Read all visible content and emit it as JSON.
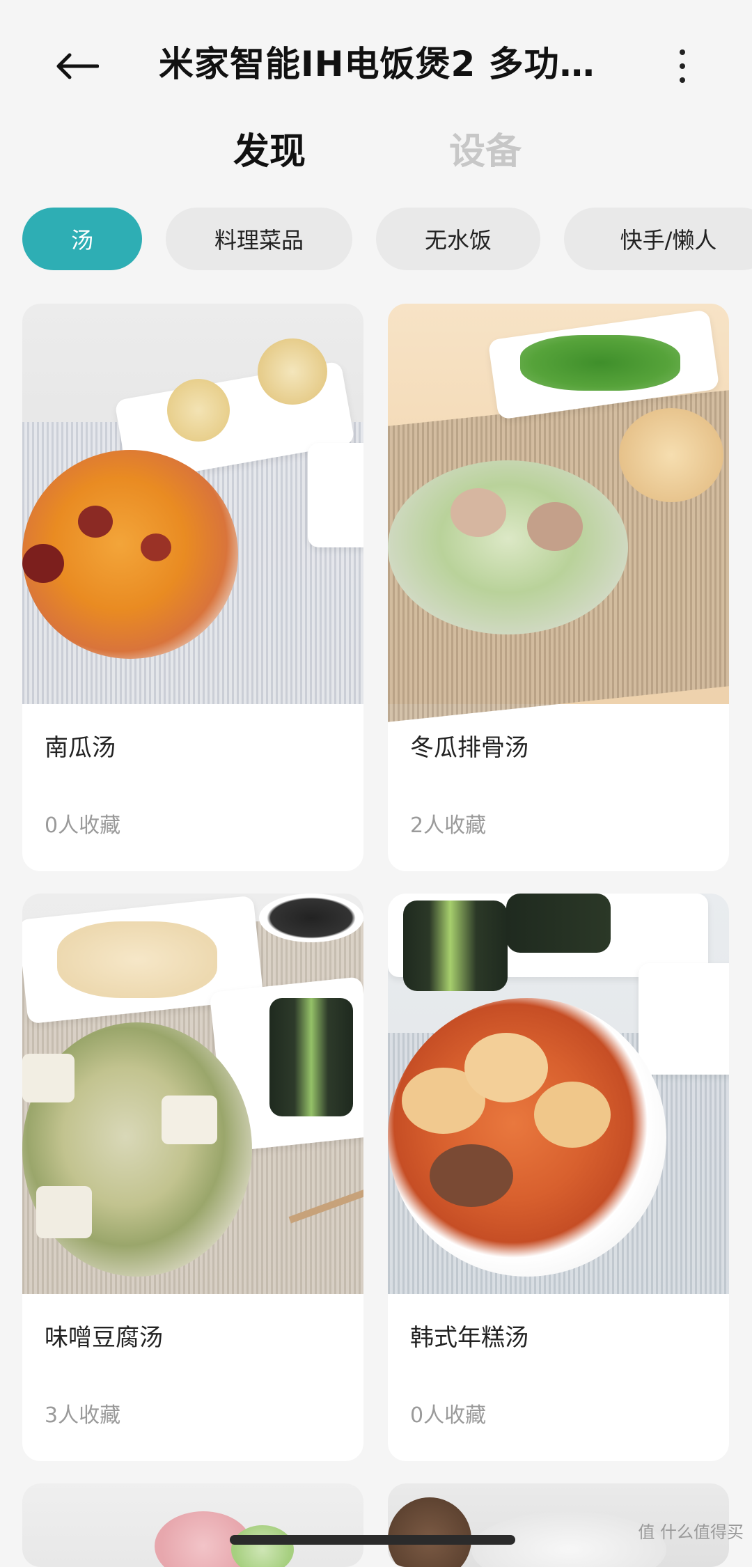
{
  "header": {
    "title": "米家智能IH电饭煲2 多功能..."
  },
  "tabs": [
    {
      "label": "发现",
      "active": true
    },
    {
      "label": "设备",
      "active": false
    }
  ],
  "chips": [
    {
      "label": "汤",
      "active": true
    },
    {
      "label": "料理菜品",
      "active": false
    },
    {
      "label": "无水饭",
      "active": false
    },
    {
      "label": "快手/懒人",
      "active": false
    }
  ],
  "recipes": [
    {
      "name": "南瓜汤",
      "favorites": "0人收藏"
    },
    {
      "name": "冬瓜排骨汤",
      "favorites": "2人收藏"
    },
    {
      "name": "味噌豆腐汤",
      "favorites": "3人收藏"
    },
    {
      "name": "韩式年糕汤",
      "favorites": "0人收藏"
    }
  ],
  "watermark": "值 什么值得买",
  "colors": {
    "accent": "#2eaeb4",
    "background": "#f5f5f5",
    "card": "#ffffff"
  },
  "icons": {
    "back": "arrow-left",
    "more": "vertical-ellipsis"
  }
}
